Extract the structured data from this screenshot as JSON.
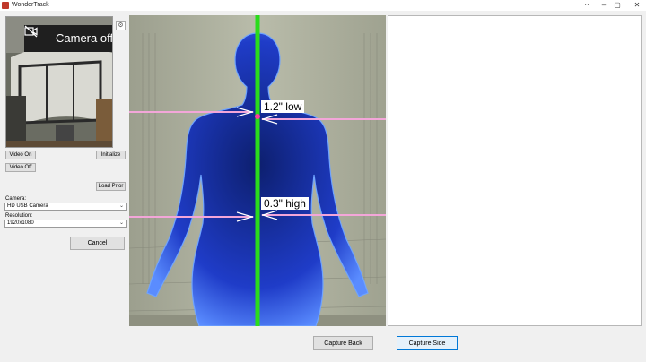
{
  "window": {
    "title": "WonderTrack",
    "controls": [
      "··",
      "–",
      "▢",
      "✕"
    ]
  },
  "preview": {
    "camera_off_label": "Camera off",
    "settings_glyph": "⚙"
  },
  "left_panel": {
    "video_on": "Video On",
    "video_off": "Video Off",
    "initialize": "Initialize",
    "load_prior": "Load Prior",
    "camera_label": "Camera:",
    "camera_value": "HD USB Camera",
    "resolution_label": "Resolution:",
    "resolution_value": "1920x1080",
    "cancel": "Cancel"
  },
  "main_view": {
    "upper_annotation": "1.2\" low",
    "lower_annotation": "0.3\" high"
  },
  "bottom_buttons": {
    "capture_back": "Capture Back",
    "capture_side": "Capture Side"
  },
  "colors": {
    "centerline": "#2bdc1c",
    "guide_lines": "#f3a6d9",
    "body": "#1f3cc8",
    "focus_border": "#0078d7"
  },
  "icons": {
    "camera_off": "video-off-icon",
    "settings": "gear-icon",
    "app": "app-icon"
  }
}
